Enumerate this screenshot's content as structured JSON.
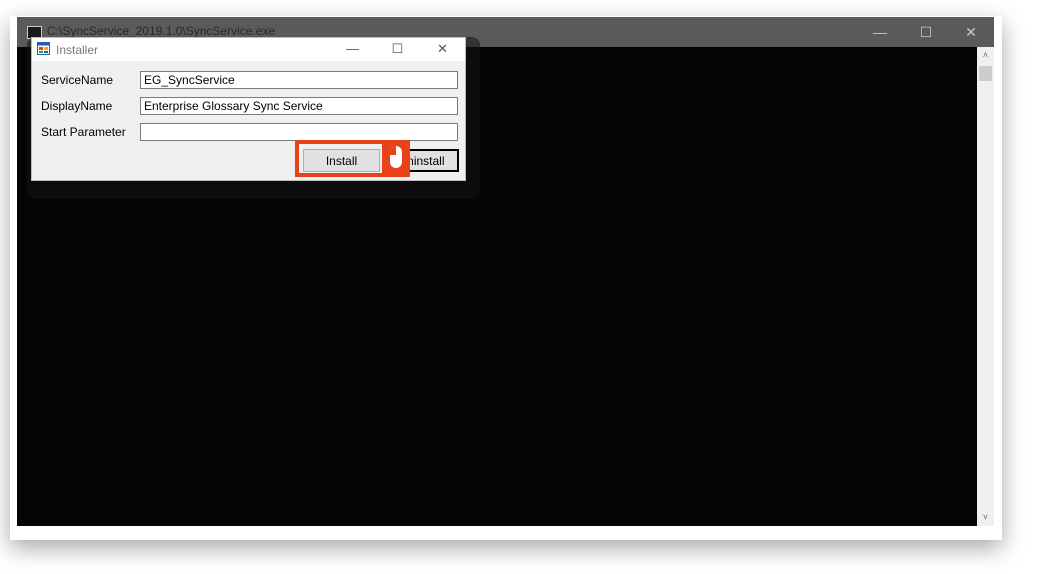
{
  "console": {
    "title": "C:\\SyncService_2019.1.0\\SyncService.exe",
    "minimize_glyph": "—",
    "maximize_glyph": "☐",
    "close_glyph": "✕",
    "scroll_up_glyph": "˄",
    "scroll_down_glyph": "˅"
  },
  "dialog": {
    "title": "Installer",
    "minimize_glyph": "—",
    "maximize_glyph": "☐",
    "close_glyph": "✕",
    "fields": [
      {
        "label": "ServiceName",
        "value": "EG_SyncService"
      },
      {
        "label": "DisplayName",
        "value": "Enterprise Glossary Sync Service"
      },
      {
        "label": "Start Parameter",
        "value": ""
      }
    ],
    "install_label": "Install",
    "uninstall_label": "Uninstall"
  },
  "annotation": {
    "highlight_color": "#e9421b",
    "icon": "mouse-left-click-icon"
  }
}
